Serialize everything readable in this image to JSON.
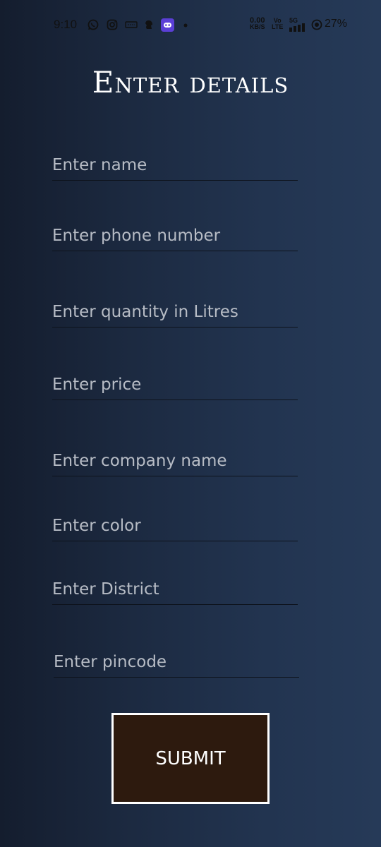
{
  "status_bar": {
    "time": "9:10",
    "left_icons": [
      "whatsapp-icon",
      "instagram-icon",
      "ticket-icon",
      "dog-icon",
      "bot-icon",
      "dot-icon"
    ],
    "data_speed_value": "0.00",
    "data_speed_unit": "KB/S",
    "volte_top": "Vo",
    "volte_bottom": "LTE",
    "network": "5G",
    "battery": "27%"
  },
  "page": {
    "title": "Enter details"
  },
  "form": {
    "fields": [
      {
        "placeholder": "Enter name",
        "value": ""
      },
      {
        "placeholder": "Enter phone number",
        "value": ""
      },
      {
        "placeholder": "Enter quantity in Litres",
        "value": ""
      },
      {
        "placeholder": "Enter price",
        "value": ""
      },
      {
        "placeholder": "Enter company name",
        "value": ""
      },
      {
        "placeholder": "Enter color",
        "value": ""
      },
      {
        "placeholder": "Enter District",
        "value": ""
      },
      {
        "placeholder": "Enter pincode",
        "value": ""
      }
    ],
    "submit_label": "SUBMIT"
  },
  "colors": {
    "background_left": "#141d2e",
    "background_right": "#263a58",
    "button_fill": "#2d1a0e",
    "button_border": "#ffffff",
    "title": "#ffffff"
  }
}
